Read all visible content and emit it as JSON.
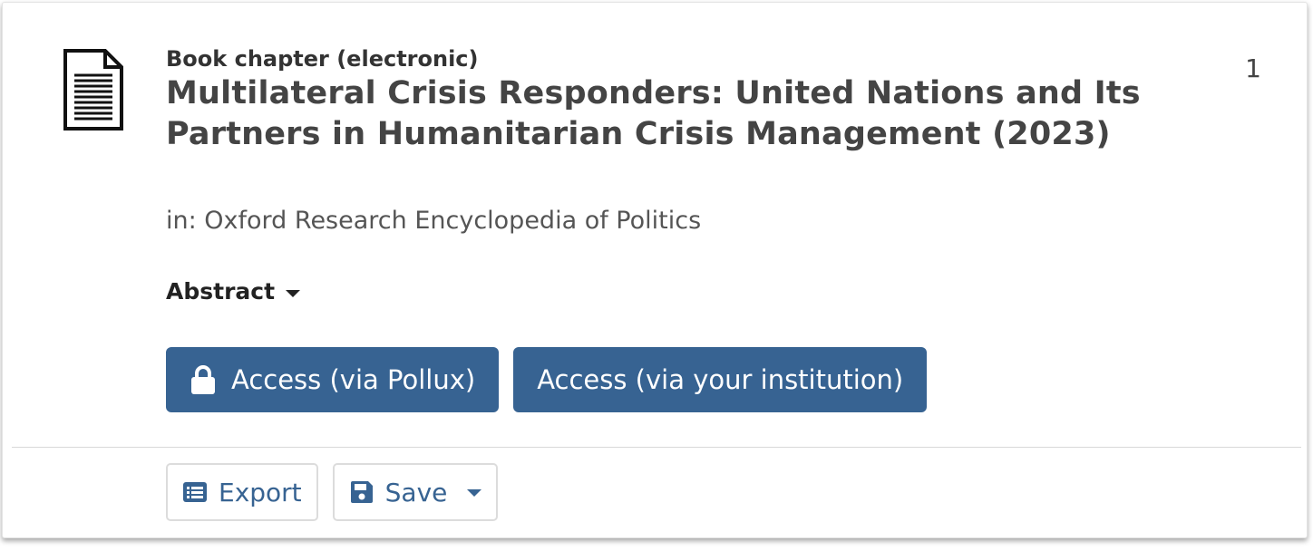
{
  "result": {
    "number": "1",
    "type_label": "Book chapter (electronic)",
    "title": "Multilateral Crisis Responders: United Nations and Its Partners in Humanitarian Crisis Management (2023)",
    "in_line": "in: Oxford Research Encyclopedia of Politics",
    "abstract_label": "Abstract",
    "icon": "document-icon"
  },
  "access_buttons": {
    "pollux_label": "Access (via Pollux)",
    "pollux_icon": "lock-icon",
    "institution_label": "Access (via your institution)"
  },
  "actions": {
    "export_label": "Export",
    "export_icon": "list-icon",
    "save_label": "Save",
    "save_icon": "floppy-disk-icon"
  },
  "colors": {
    "accent": "#376392",
    "title_text": "#444444",
    "border": "#dcdcdc"
  }
}
